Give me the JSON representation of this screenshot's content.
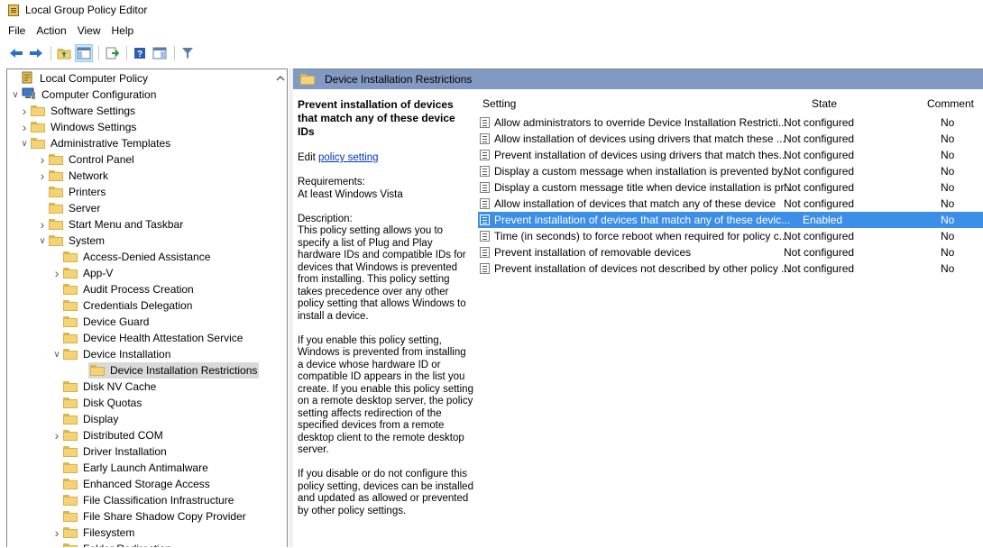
{
  "window": {
    "title": "Local Group Policy Editor"
  },
  "menu": [
    "File",
    "Action",
    "View",
    "Help"
  ],
  "toolbar": {
    "icons": [
      "back-arrow-icon",
      "forward-arrow-icon",
      "up-folder-icon",
      "show-hide-tree-icon",
      "export-list-icon",
      "help-icon",
      "extended-view-icon",
      "filter-icon"
    ]
  },
  "tree": {
    "items": [
      {
        "label": "Local Computer Policy",
        "level": 0,
        "arrow": "",
        "icon": "policy"
      },
      {
        "label": "Computer Configuration",
        "level": 0,
        "arrow": "expanded",
        "icon": "computer"
      },
      {
        "label": "Software Settings",
        "level": 1,
        "arrow": "collapsed",
        "icon": "folder"
      },
      {
        "label": "Windows Settings",
        "level": 1,
        "arrow": "collapsed",
        "icon": "folder"
      },
      {
        "label": "Administrative Templates",
        "level": 1,
        "arrow": "expanded",
        "icon": "folder"
      },
      {
        "label": "Control Panel",
        "level": 2,
        "arrow": "collapsed",
        "icon": "folder"
      },
      {
        "label": "Network",
        "level": 2,
        "arrow": "collapsed",
        "icon": "folder"
      },
      {
        "label": "Printers",
        "level": 2,
        "arrow": "",
        "icon": "folder"
      },
      {
        "label": "Server",
        "level": 2,
        "arrow": "",
        "icon": "folder"
      },
      {
        "label": "Start Menu and Taskbar",
        "level": 2,
        "arrow": "collapsed",
        "icon": "folder"
      },
      {
        "label": "System",
        "level": 2,
        "arrow": "expanded",
        "icon": "folder"
      },
      {
        "label": "Access-Denied Assistance",
        "level": 3,
        "arrow": "",
        "icon": "folder"
      },
      {
        "label": "App-V",
        "level": 3,
        "arrow": "collapsed",
        "icon": "folder"
      },
      {
        "label": "Audit Process Creation",
        "level": 3,
        "arrow": "",
        "icon": "folder"
      },
      {
        "label": "Credentials Delegation",
        "level": 3,
        "arrow": "",
        "icon": "folder"
      },
      {
        "label": "Device Guard",
        "level": 3,
        "arrow": "",
        "icon": "folder"
      },
      {
        "label": "Device Health Attestation Service",
        "level": 3,
        "arrow": "",
        "icon": "folder"
      },
      {
        "label": "Device Installation",
        "level": 3,
        "arrow": "expanded",
        "icon": "folder"
      },
      {
        "label": "Device Installation Restrictions",
        "level": 4,
        "arrow": "",
        "icon": "folder",
        "selected": true
      },
      {
        "label": "Disk NV Cache",
        "level": 3,
        "arrow": "",
        "icon": "folder"
      },
      {
        "label": "Disk Quotas",
        "level": 3,
        "arrow": "",
        "icon": "folder"
      },
      {
        "label": "Display",
        "level": 3,
        "arrow": "",
        "icon": "folder"
      },
      {
        "label": "Distributed COM",
        "level": 3,
        "arrow": "collapsed",
        "icon": "folder"
      },
      {
        "label": "Driver Installation",
        "level": 3,
        "arrow": "",
        "icon": "folder"
      },
      {
        "label": "Early Launch Antimalware",
        "level": 3,
        "arrow": "",
        "icon": "folder"
      },
      {
        "label": "Enhanced Storage Access",
        "level": 3,
        "arrow": "",
        "icon": "folder"
      },
      {
        "label": "File Classification Infrastructure",
        "level": 3,
        "arrow": "",
        "icon": "folder"
      },
      {
        "label": "File Share Shadow Copy Provider",
        "level": 3,
        "arrow": "",
        "icon": "folder"
      },
      {
        "label": "Filesystem",
        "level": 3,
        "arrow": "collapsed",
        "icon": "folder"
      },
      {
        "label": "Folder Redirection",
        "level": 3,
        "arrow": "",
        "icon": "folder"
      }
    ]
  },
  "right": {
    "header": "Device Installation Restrictions",
    "desc": {
      "title": "Prevent installation of devices that match any of these device IDs",
      "edit_prefix": "Edit ",
      "edit_link": "policy setting",
      "requirements_label": "Requirements:",
      "requirements_value": "At least Windows Vista",
      "description_label": "Description:",
      "p1": "This policy setting allows you to specify a list of Plug and Play hardware IDs and compatible IDs for devices that Windows is prevented from installing. This policy setting takes precedence over any other policy setting that allows Windows to install a device.",
      "p2": "If you enable this policy setting, Windows is prevented from installing a device whose hardware ID or compatible ID appears in the list you create. If you enable this policy setting on a remote desktop server, the policy setting affects redirection of the specified devices from a remote desktop client to the remote desktop server.",
      "p3": "If you disable or do not configure this policy setting, devices can be installed and updated as allowed or prevented by other policy settings."
    },
    "columns": {
      "setting": "Setting",
      "state": "State",
      "comment": "Comment"
    },
    "rows": [
      {
        "setting": "Allow administrators to override Device Installation Restricti...",
        "state": "Not configured",
        "comment": "No"
      },
      {
        "setting": "Allow installation of devices using drivers that match these ...",
        "state": "Not configured",
        "comment": "No"
      },
      {
        "setting": "Prevent installation of devices using drivers that match thes...",
        "state": "Not configured",
        "comment": "No"
      },
      {
        "setting": "Display a custom message when installation is prevented by...",
        "state": "Not configured",
        "comment": "No"
      },
      {
        "setting": "Display a custom message title when device installation is pr...",
        "state": "Not configured",
        "comment": "No"
      },
      {
        "setting": "Allow installation of devices that match any of these device",
        "state": "Not configured",
        "comment": "No"
      },
      {
        "setting": "Prevent installation of devices that match any of these devic...",
        "state": "Enabled",
        "comment": "No",
        "selected": true
      },
      {
        "setting": "Time (in seconds) to force reboot when required for policy c...",
        "state": "Not configured",
        "comment": "No"
      },
      {
        "setting": "Prevent installation of removable devices",
        "state": "Not configured",
        "comment": "No"
      },
      {
        "setting": "Prevent installation of devices not described by other policy ...",
        "state": "Not configured",
        "comment": "No"
      }
    ]
  }
}
